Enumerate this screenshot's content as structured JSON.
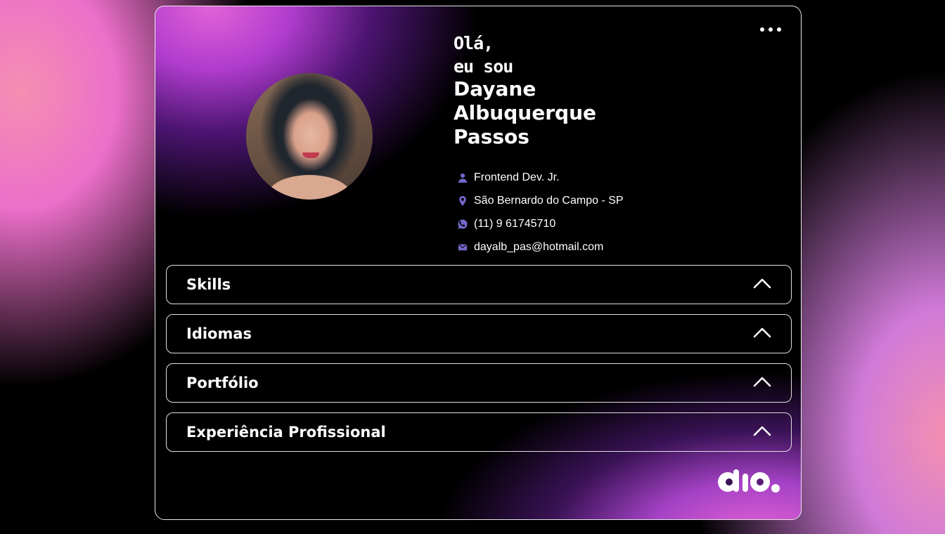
{
  "profile": {
    "greeting_line1": "Olá,",
    "greeting_line2": "eu sou",
    "name_line1": "Dayane",
    "name_line2": "Albuquerque",
    "name_line3": "Passos"
  },
  "info": {
    "role": "Frontend Dev. Jr.",
    "location": "São Bernardo do Campo - SP",
    "phone": "(11) 9 61745710",
    "email": "dayalb_pas@hotmail.com"
  },
  "sections": [
    {
      "label": "Skills"
    },
    {
      "label": "Idiomas"
    },
    {
      "label": "Portfólio"
    },
    {
      "label": "Experiência Profissional"
    }
  ],
  "brand": {
    "logo": "dio."
  },
  "icons": {
    "role": "user-icon",
    "location": "map-pin-icon",
    "phone": "whatsapp-icon",
    "email": "mail-icon"
  },
  "colors": {
    "accent_icon": "#7168c9",
    "gradient_pink": "#f48fb1",
    "gradient_purple": "#b03ccd",
    "card_bg": "#000000",
    "border": "#e8e8e8"
  }
}
